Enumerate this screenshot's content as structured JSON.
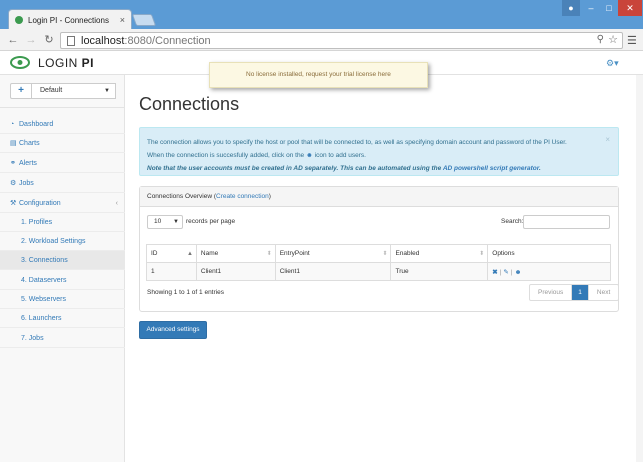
{
  "browser": {
    "tab_title": "Login PI - Connections",
    "tab_close": "×",
    "url_host": "localhost",
    "url_path": ":8080/Connection",
    "icons": [
      "back-icon",
      "forward-icon",
      "reload-icon",
      "zoom-icon",
      "star-icon",
      "menu-icon"
    ]
  },
  "app": {
    "logo_a": "LOGIN",
    "logo_b": " PI",
    "notice": "No license installed, request your trial license here",
    "brand_color": "#3c9a4f",
    "accent_color": "#337ab7"
  },
  "sidebar": {
    "env_add": "+",
    "environment": "Default",
    "items": [
      {
        "label": "Dashboard",
        "icon": "dashboard-icon"
      },
      {
        "label": "Charts",
        "icon": "chart-icon"
      },
      {
        "label": "Alerts",
        "icon": "alert-icon"
      },
      {
        "label": "Jobs",
        "icon": "jobs-icon"
      },
      {
        "label": "Configuration",
        "icon": "wrench-icon"
      }
    ],
    "sub_items": [
      {
        "label": "1. Profiles"
      },
      {
        "label": "2. Workload Settings"
      },
      {
        "label": "3. Connections",
        "active": true
      },
      {
        "label": "4. Dataservers"
      },
      {
        "label": "5. Webservers"
      },
      {
        "label": "6. Launchers"
      },
      {
        "label": "7. Jobs"
      }
    ]
  },
  "main": {
    "title": "Connections",
    "info": {
      "line1": "The connection allows you to specify the host or pool that will be connected to, as well as specifying domain account and password of the PI User.",
      "line2_a": "When the connection is succesfully added, click on the",
      "line2_b": "icon to add users.",
      "line3_a": "Note that the user accounts must be created in AD separately. This can be automated using the",
      "line3_link": "AD powershell script generator",
      "line3_b": ".",
      "close": "×"
    },
    "panel": {
      "heading": "Connections Overview (",
      "heading_link": "Create connection",
      "heading_end": ")",
      "page_length": "10",
      "page_length_label": "records per page",
      "search_label": "Search:",
      "columns": [
        "ID",
        "Name",
        "EntryPoint",
        "Enabled",
        "Options"
      ],
      "rows": [
        {
          "id": "1",
          "name": "Client1",
          "entry": "Client1",
          "enabled": "True"
        }
      ],
      "showing": "Showing 1 to 1 of 1 entries",
      "pager": {
        "prev": "Previous",
        "current": "1",
        "next": "Next"
      }
    },
    "advanced_button": "Advanced settings"
  }
}
